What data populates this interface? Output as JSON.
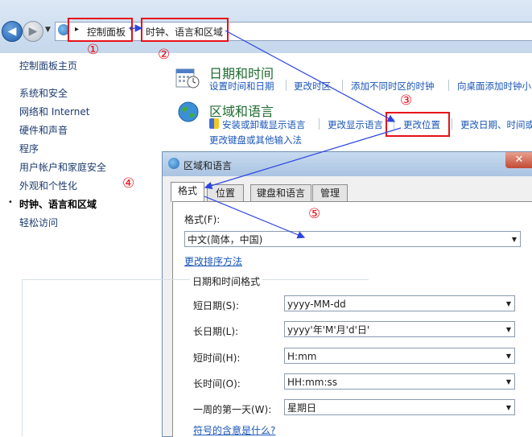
{
  "address_bar": {
    "breadcrumb": [
      "控制面板",
      "时钟、语言和区域"
    ],
    "history_dropdown_icon": "chevron-down-icon"
  },
  "annotations": [
    "①",
    "②",
    "③",
    "④",
    "⑤"
  ],
  "sidebar": {
    "home": "控制面板主页",
    "items": [
      "系统和安全",
      "网络和 Internet",
      "硬件和声音",
      "程序",
      "用户帐户和家庭安全",
      "外观和个性化",
      "时钟、语言和区域",
      "轻松访问"
    ],
    "active_index": 6
  },
  "sections": {
    "datetime": {
      "title": "日期和时间",
      "links": [
        "设置时间和日期",
        "更改时区",
        "添加不同时区的时钟",
        "向桌面添加时钟小"
      ]
    },
    "region": {
      "title": "区域和语言",
      "links": [
        "安装或卸载显示语言",
        "更改显示语言",
        "更改位置",
        "更改日期、时间或"
      ],
      "link2": "更改键盘或其他输入法"
    }
  },
  "dialog": {
    "title": "区域和语言",
    "tabs": [
      "格式",
      "位置",
      "键盘和语言",
      "管理"
    ],
    "selected_tab": 0,
    "format_label": "格式(F):",
    "format_value": "中文(简体，中国)",
    "sort_link": "更改排序方法",
    "group_title": "日期和时间格式",
    "fields": [
      {
        "label": "短日期(S):",
        "value": "yyyy-MM-dd"
      },
      {
        "label": "长日期(L):",
        "value": "yyyy'年'M'月'd'日'"
      },
      {
        "label": "短时间(H):",
        "value": "H:mm"
      },
      {
        "label": "长时间(O):",
        "value": "HH:mm:ss"
      },
      {
        "label": "一周的第一天(W):",
        "value": "星期日"
      }
    ],
    "symbols_link": "符号的含意是什么?"
  },
  "colors": {
    "annotation": "#e8101a",
    "link": "#1a56b8",
    "arrow": "#2b45e0",
    "section_title": "#1e6b2f"
  }
}
